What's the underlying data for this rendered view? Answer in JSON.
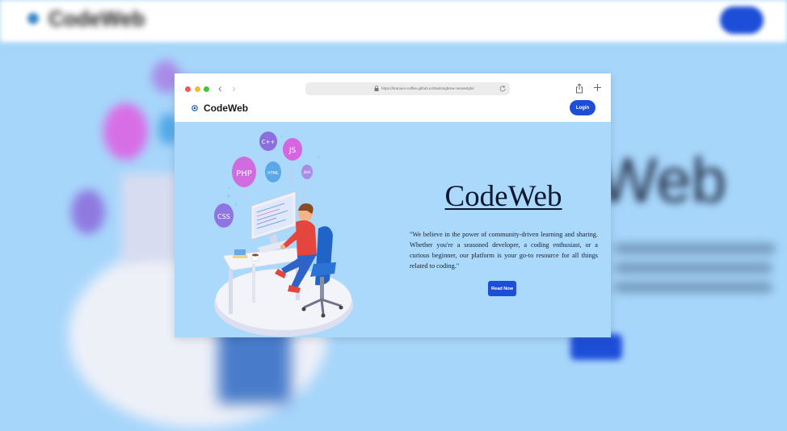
{
  "background": {
    "brand": "CodeWeb",
    "login_label": "Login",
    "big_word": "Web"
  },
  "browser": {
    "url": "https://kranium-coffee.github.io/Starkingbrew-Versestyle/"
  },
  "site": {
    "brand": "CodeWeb",
    "login_label": "Login"
  },
  "hero": {
    "title": "CodeWeb",
    "quote": "\"We believe in the power of community-driven learning and sharing. Whether you're a seasoned developer, a coding enthusiast, or a curious beginner, our platform is your go-to resource for all things related to coding.\"",
    "button_label": "Read Now"
  },
  "illustration": {
    "bubbles": [
      "C++",
      "JS",
      "PHP",
      "HTML",
      "JAVA",
      "CSS"
    ]
  },
  "colors": {
    "accent": "#1d4ed8",
    "sky": "#aad9fb",
    "text_dark": "#0e1730"
  },
  "icons": [
    "logo-icon",
    "lock-icon",
    "reload-icon",
    "share-icon",
    "plus-icon",
    "back-arrow-icon",
    "forward-arrow-icon"
  ]
}
